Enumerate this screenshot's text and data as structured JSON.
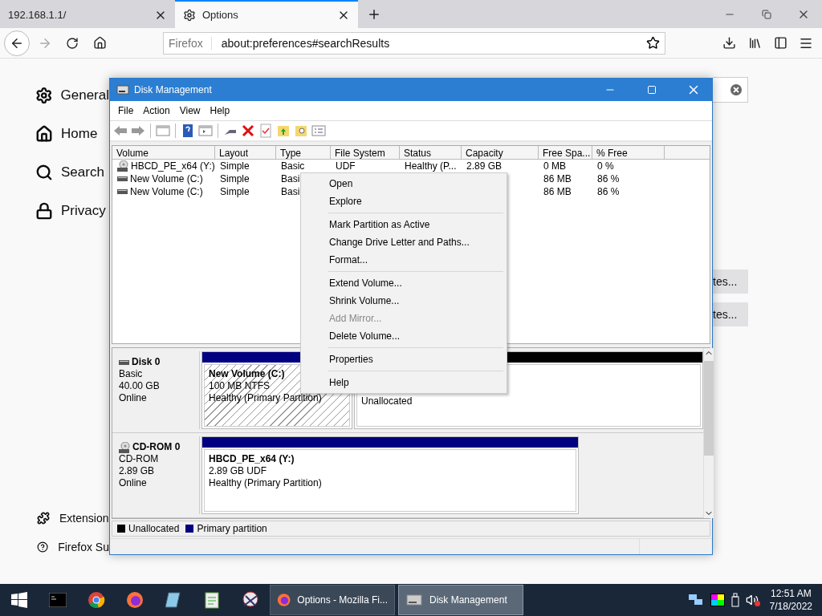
{
  "browser": {
    "tabs": [
      {
        "label": "192.168.1.1/",
        "selected": false
      },
      {
        "label": "Options",
        "selected": true
      }
    ],
    "identity": "Firefox",
    "url": "about:preferences#searchResults"
  },
  "preferences": {
    "sidebar": [
      {
        "label": "General",
        "kind": "gear"
      },
      {
        "label": "Home",
        "kind": "home"
      },
      {
        "label": "Search",
        "kind": "search"
      },
      {
        "label": "Privacy",
        "kind": "lock"
      }
    ],
    "footer": [
      {
        "label": "Extension",
        "kind": "puzzle"
      },
      {
        "label": "Firefox Su",
        "kind": "help"
      }
    ],
    "buttons": [
      "tes...",
      "tes..."
    ]
  },
  "disk_management": {
    "title": "Disk Management",
    "menu": [
      "File",
      "Action",
      "View",
      "Help"
    ],
    "columns": [
      "Volume",
      "Layout",
      "Type",
      "File System",
      "Status",
      "Capacity",
      "Free Spa...",
      "% Free"
    ],
    "rows": [
      {
        "kind": "cdrom",
        "cells": [
          "HBCD_PE_x64 (Y:)",
          "Simple",
          "Basic",
          "UDF",
          "Healthy (P...",
          "2.89 GB",
          "0 MB",
          "0 %"
        ]
      },
      {
        "kind": "drive",
        "cells": [
          "New Volume (C:)",
          "Simple",
          "Basi",
          "",
          "",
          "",
          "86 MB",
          "86 %"
        ]
      },
      {
        "kind": "drive",
        "cells": [
          "New Volume (C:)",
          "Simple",
          "Basi",
          "",
          "",
          "",
          "86 MB",
          "86 %"
        ]
      }
    ],
    "disks": [
      {
        "kind": "disk",
        "name": "Disk 0",
        "type": "Basic",
        "size": "40.00 GB",
        "state": "Online",
        "partitions": [
          {
            "title": "New Volume  (C:)",
            "detail": "100 MB NTFS",
            "status": "Healthy (Primary Partition)",
            "color": "#000080",
            "selected": true
          },
          {
            "status": "Unallocated",
            "color": "#000000",
            "selected": false
          }
        ]
      },
      {
        "kind": "cdrom",
        "name": "CD-ROM 0",
        "type": "CD-ROM",
        "size": "2.89 GB",
        "state": "Online",
        "partitions": [
          {
            "title": "HBCD_PE_x64  (Y:)",
            "detail": "2.89 GB UDF",
            "status": "Healthy (Primary Partition)",
            "color": "#000080",
            "selected": false
          }
        ]
      }
    ],
    "legend": [
      {
        "label": "Unallocated",
        "color": "#000000"
      },
      {
        "label": "Primary partition",
        "color": "#000080"
      }
    ]
  },
  "context_menu": [
    {
      "kind": "item",
      "label": "Open",
      "disabled": false
    },
    {
      "kind": "item",
      "label": "Explore",
      "disabled": false
    },
    {
      "kind": "separator"
    },
    {
      "kind": "item",
      "label": "Mark Partition as Active",
      "disabled": false
    },
    {
      "kind": "item",
      "label": "Change Drive Letter and Paths...",
      "disabled": false
    },
    {
      "kind": "item",
      "label": "Format...",
      "disabled": false
    },
    {
      "kind": "separator"
    },
    {
      "kind": "item",
      "label": "Extend Volume...",
      "disabled": false
    },
    {
      "kind": "item",
      "label": "Shrink Volume...",
      "disabled": false
    },
    {
      "kind": "item",
      "label": "Add Mirror...",
      "disabled": true
    },
    {
      "kind": "item",
      "label": "Delete Volume...",
      "disabled": false
    },
    {
      "kind": "separator"
    },
    {
      "kind": "item",
      "label": "Properties",
      "disabled": false
    },
    {
      "kind": "separator"
    },
    {
      "kind": "item",
      "label": "Help",
      "disabled": false
    }
  ],
  "taskbar": {
    "apps": [
      {
        "label": "Options - Mozilla Fi...",
        "kind": "firefox",
        "selected": false
      },
      {
        "label": "Disk Management",
        "kind": "disk",
        "selected": true
      }
    ],
    "time": "12:51 AM",
    "date": "7/18/2022"
  }
}
